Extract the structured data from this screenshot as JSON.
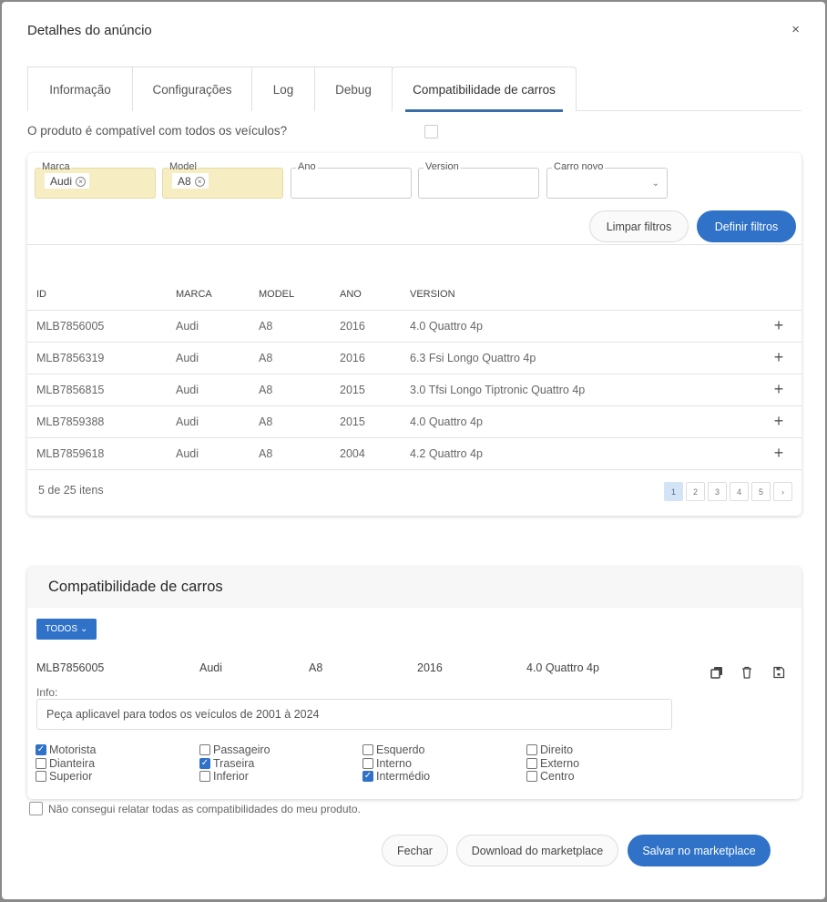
{
  "modal": {
    "title": "Detalhes do anúncio",
    "close_label": "×"
  },
  "tabs": [
    {
      "label": "Informação",
      "active": false
    },
    {
      "label": "Configurações",
      "active": false
    },
    {
      "label": "Log",
      "active": false
    },
    {
      "label": "Debug",
      "active": false
    },
    {
      "label": "Compatibilidade de carros",
      "active": true
    }
  ],
  "compat_all": {
    "question": "O produto é compatível com todos os veículos?",
    "checked": false
  },
  "filters": {
    "marca": {
      "label": "Marca",
      "chip": "Audi"
    },
    "model": {
      "label": "Model",
      "chip": "A8"
    },
    "ano": {
      "label": "Ano",
      "value": ""
    },
    "version": {
      "label": "Version",
      "value": ""
    },
    "carro_novo": {
      "label": "Carro novo",
      "value": ""
    },
    "clear_label": "Limpar filtros",
    "apply_label": "Definir filtros"
  },
  "table": {
    "columns": [
      "ID",
      "MARCA",
      "MODEL",
      "ANO",
      "VERSION"
    ],
    "rows": [
      {
        "id": "MLB7856005",
        "marca": "Audi",
        "model": "A8",
        "ano": "2016",
        "version": "4.0 Quattro 4p"
      },
      {
        "id": "MLB7856319",
        "marca": "Audi",
        "model": "A8",
        "ano": "2016",
        "version": "6.3 Fsi Longo Quattro 4p"
      },
      {
        "id": "MLB7856815",
        "marca": "Audi",
        "model": "A8",
        "ano": "2015",
        "version": "3.0 Tfsi Longo Tiptronic Quattro 4p"
      },
      {
        "id": "MLB7859388",
        "marca": "Audi",
        "model": "A8",
        "ano": "2015",
        "version": "4.0 Quattro 4p"
      },
      {
        "id": "MLB7859618",
        "marca": "Audi",
        "model": "A8",
        "ano": "2004",
        "version": "4.2 Quattro 4p"
      }
    ],
    "add_icon": "+",
    "items_count": "5 de 25 itens",
    "pages": [
      "1",
      "2",
      "3",
      "4",
      "5"
    ],
    "current_page": "1",
    "next_icon": "›"
  },
  "compat_section": {
    "title": "Compatibilidade de carros",
    "todos_label": "TODOS",
    "entry": {
      "id": "MLB7856005",
      "marca": "Audi",
      "model": "A8",
      "ano": "2016",
      "version": "4.0 Quattro 4p"
    },
    "info_label": "Info:",
    "info_value": "Peça aplicavel para todos os veículos de 2001 à 2024",
    "positions": [
      [
        {
          "label": "Motorista",
          "checked": true
        },
        {
          "label": "Dianteira",
          "checked": false
        },
        {
          "label": "Superior",
          "checked": false
        }
      ],
      [
        {
          "label": "Passageiro",
          "checked": false
        },
        {
          "label": "Traseira",
          "checked": true
        },
        {
          "label": "Inferior",
          "checked": false
        }
      ],
      [
        {
          "label": "Esquerdo",
          "checked": false
        },
        {
          "label": "Interno",
          "checked": false
        },
        {
          "label": "Intermédio",
          "checked": true
        }
      ],
      [
        {
          "label": "Direito",
          "checked": false
        },
        {
          "label": "Externo",
          "checked": false
        },
        {
          "label": "Centro",
          "checked": false
        }
      ]
    ]
  },
  "not_all_compat": {
    "label": "Não consegui relatar todas as compatibilidades do meu produto.",
    "checked": false
  },
  "footer": {
    "close_label": "Fechar",
    "download_label": "Download do marketplace",
    "save_label": "Salvar no marketplace"
  },
  "colors": {
    "primary": "#2f72c7",
    "chip_bg": "#f6eec2",
    "active_tab_underline": "#3b6ea8",
    "active_page": "#d3e4f7"
  }
}
